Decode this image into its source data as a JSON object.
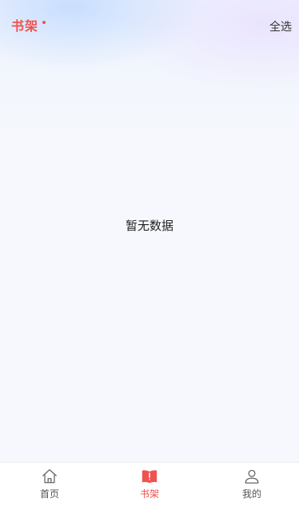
{
  "header": {
    "title": "书架",
    "select_all": "全选"
  },
  "main": {
    "empty_text": "暂无数据"
  },
  "tabbar": {
    "items": [
      {
        "label": "首页",
        "icon": "home-icon",
        "active": false
      },
      {
        "label": "书架",
        "icon": "bookshelf-icon",
        "active": true
      },
      {
        "label": "我的",
        "icon": "user-icon",
        "active": false
      }
    ]
  },
  "colors": {
    "accent": "#f0524f",
    "text": "#333333",
    "background": "#f6f8fd"
  }
}
